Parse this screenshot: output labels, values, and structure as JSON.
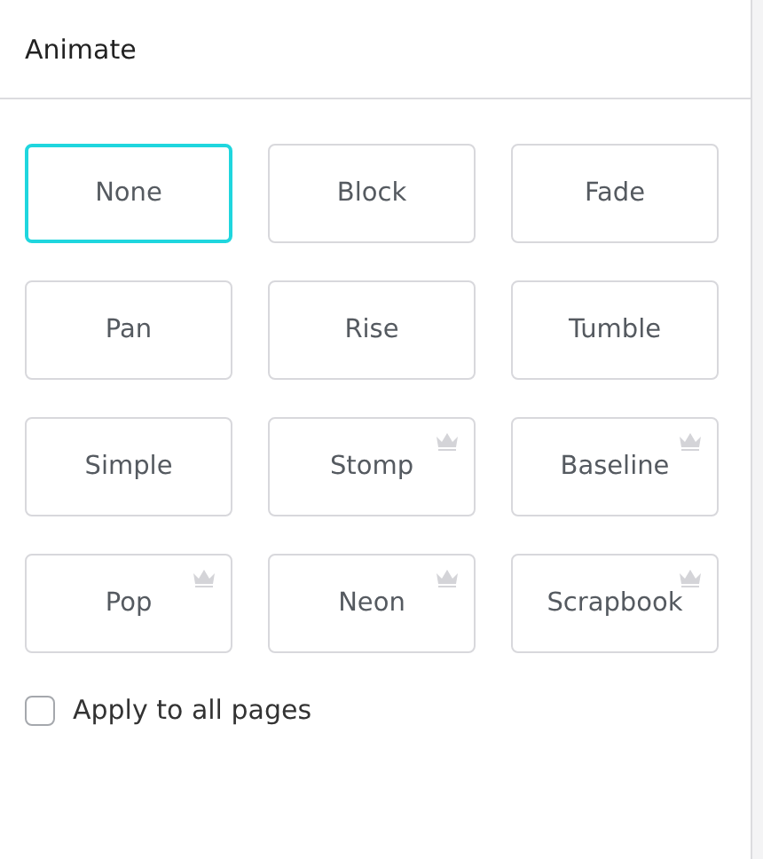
{
  "panel": {
    "title": "Animate"
  },
  "animations": [
    {
      "label": "None",
      "selected": true,
      "premium": false
    },
    {
      "label": "Block",
      "selected": false,
      "premium": false
    },
    {
      "label": "Fade",
      "selected": false,
      "premium": false
    },
    {
      "label": "Pan",
      "selected": false,
      "premium": false
    },
    {
      "label": "Rise",
      "selected": false,
      "premium": false
    },
    {
      "label": "Tumble",
      "selected": false,
      "premium": false
    },
    {
      "label": "Simple",
      "selected": false,
      "premium": false
    },
    {
      "label": "Stomp",
      "selected": false,
      "premium": true
    },
    {
      "label": "Baseline",
      "selected": false,
      "premium": true
    },
    {
      "label": "Pop",
      "selected": false,
      "premium": true
    },
    {
      "label": "Neon",
      "selected": false,
      "premium": true
    },
    {
      "label": "Scrapbook",
      "selected": false,
      "premium": true
    }
  ],
  "apply_all": {
    "label": "Apply to all pages",
    "checked": false
  }
}
